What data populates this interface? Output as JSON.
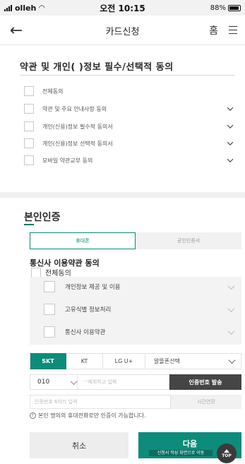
{
  "status_bar": {
    "carrier": "olleh",
    "time": "오전 10:15",
    "battery": "88%"
  },
  "header": {
    "title": "카드신청",
    "home_label": "홈"
  },
  "terms": {
    "title": "약관 및 개인(    )정보 필수/선택적 동의",
    "items": [
      {
        "label": "전체동의",
        "expandable": false
      },
      {
        "label": "약관 및 주요 안내사항 동의",
        "expandable": true
      },
      {
        "label": "개인(신용)정보 필수적 동의서",
        "expandable": true
      },
      {
        "label": "개인(신용)정보 선택적 동의서",
        "expandable": true
      },
      {
        "label": "모바일 약관교부 동의",
        "expandable": true
      }
    ]
  },
  "identity": {
    "title": "본인인증",
    "tabs": [
      {
        "label": "휴대폰",
        "active": true
      },
      {
        "label": "공인인증서",
        "active": false
      }
    ],
    "carrier_terms_title": "통신사 이용약관 동의",
    "agree_all": "전체동의",
    "sub_items": [
      "개인정보 제공 및 이용",
      "고유식별 정보처리",
      "통신사 이용약관"
    ],
    "carriers": [
      "SKT",
      "KT",
      "LG U+",
      "알뜰폰선택"
    ],
    "active_carrier": "SKT",
    "phone_prefix": "010",
    "phone_placeholder": "'-'제외하고 입력",
    "send_button": "인증번호 발송",
    "code_placeholder": "인증번호 6자리 입력",
    "timer_label": "시간연장",
    "notice": "본인 명의의 휴대전화로만 인증이 가능합니다."
  },
  "actions": {
    "cancel": "취소",
    "next": "다음",
    "next_caption": "신청서 작성 화면으로 이동",
    "top": "TOP"
  },
  "colors": {
    "accent": "#0d8c7b",
    "dark_button": "#454545"
  }
}
